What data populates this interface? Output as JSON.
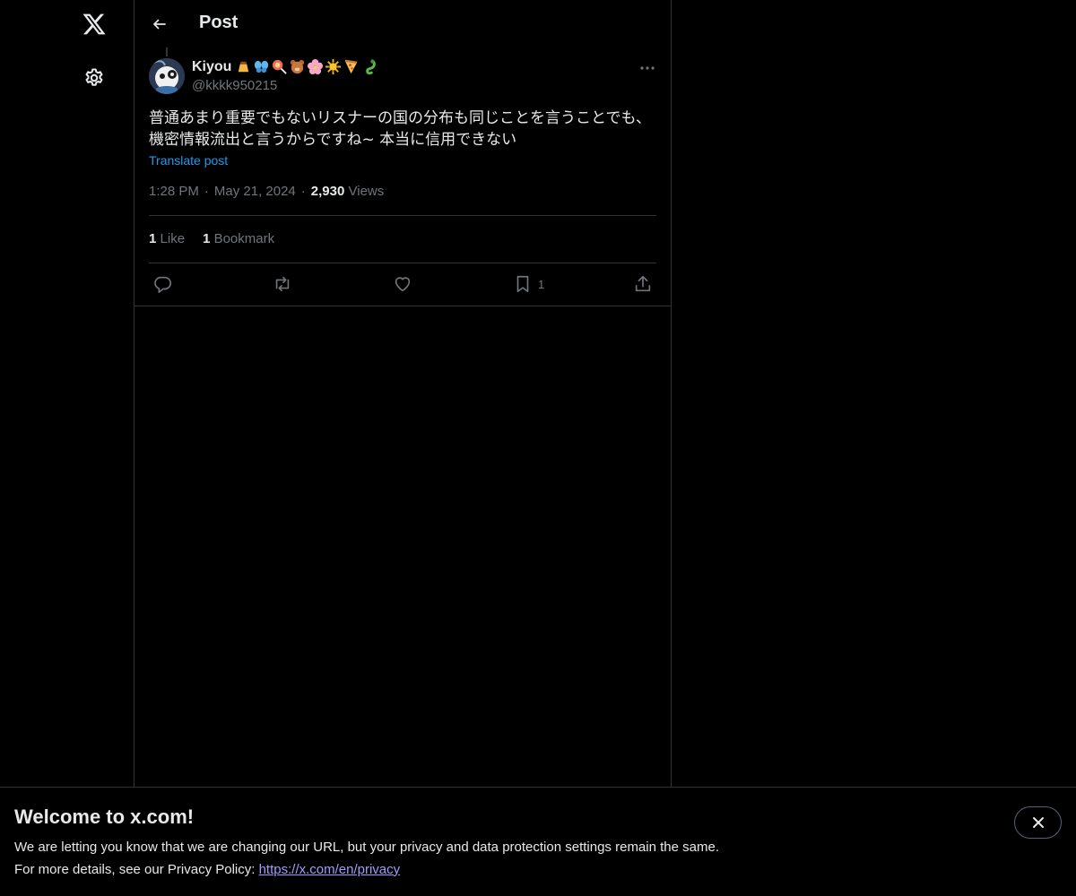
{
  "nav": {
    "logo_icon": "x-logo-icon",
    "settings_icon": "gear-icon"
  },
  "header": {
    "back_icon": "arrow-left-icon",
    "title": "Post"
  },
  "post": {
    "author": {
      "name": "Kiyou",
      "name_emojis": [
        "🍮",
        "🦋",
        "🍭",
        "🐻",
        "🌸",
        "🌞",
        "🍕",
        "🐉"
      ],
      "handle": "@kkkk950215"
    },
    "text_lines": [
      "普通あまり重要でもないリスナーの国の分布も同じことを言うことでも、",
      "機密情報流出と言うからですね~ 本当に信用できない"
    ],
    "translate_label": "Translate post",
    "time": "1:28 PM",
    "separator": "·",
    "date": "May 21, 2024",
    "views_count": "2,930",
    "views_label": "Views",
    "likes_count": "1",
    "likes_label": "Like",
    "bookmarks_count": "1",
    "bookmarks_label": "Bookmark",
    "actions": {
      "bookmark_count": "1"
    }
  },
  "banner": {
    "title": "Welcome to x.com!",
    "line1": "We are letting you know that we are changing our URL, but your privacy and data protection settings remain the same.",
    "line2_prefix": "For more details, see our Privacy Policy: ",
    "link": "https://x.com/en/privacy"
  },
  "colors": {
    "background": "#000000",
    "text": "#e7e9ea",
    "muted": "#71767b",
    "accent": "#1d9bf0",
    "border": "#2f3336",
    "link_visited": "#a29bfe"
  }
}
